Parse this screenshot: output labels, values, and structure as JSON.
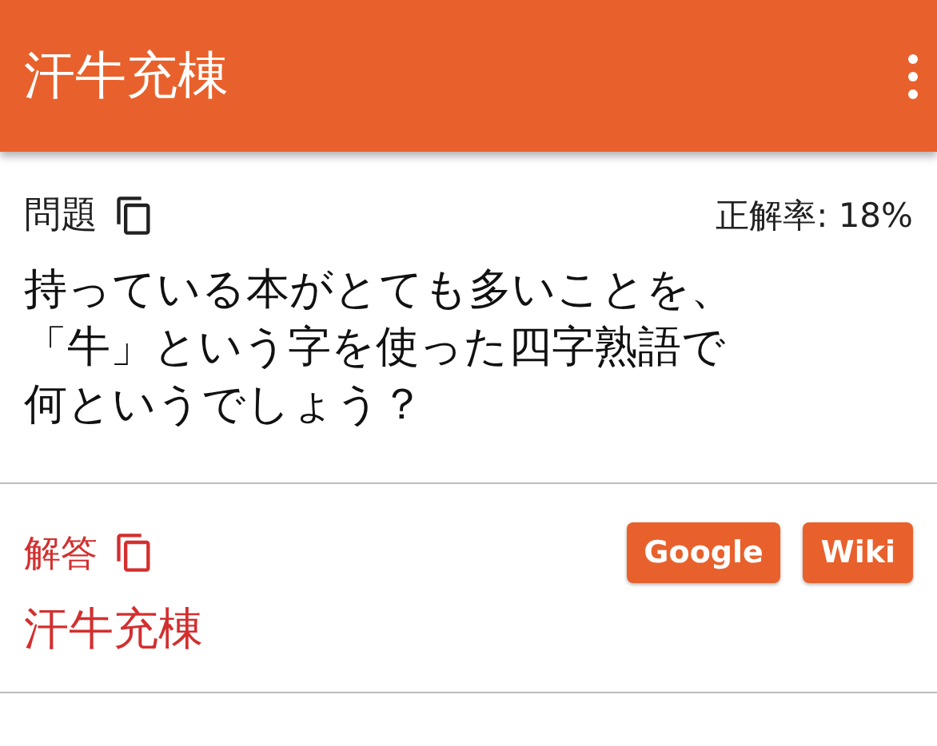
{
  "app_bar": {
    "title": "汗牛充棟"
  },
  "question": {
    "label": "問題",
    "accuracy": "正解率: 18%",
    "text": "持っている本がとても多いことを、「牛」という字を使った四字熟語で何というでしょう？"
  },
  "answer": {
    "label": "解答",
    "buttons": [
      "Google",
      "Wiki"
    ],
    "text": "汗牛充棟"
  }
}
